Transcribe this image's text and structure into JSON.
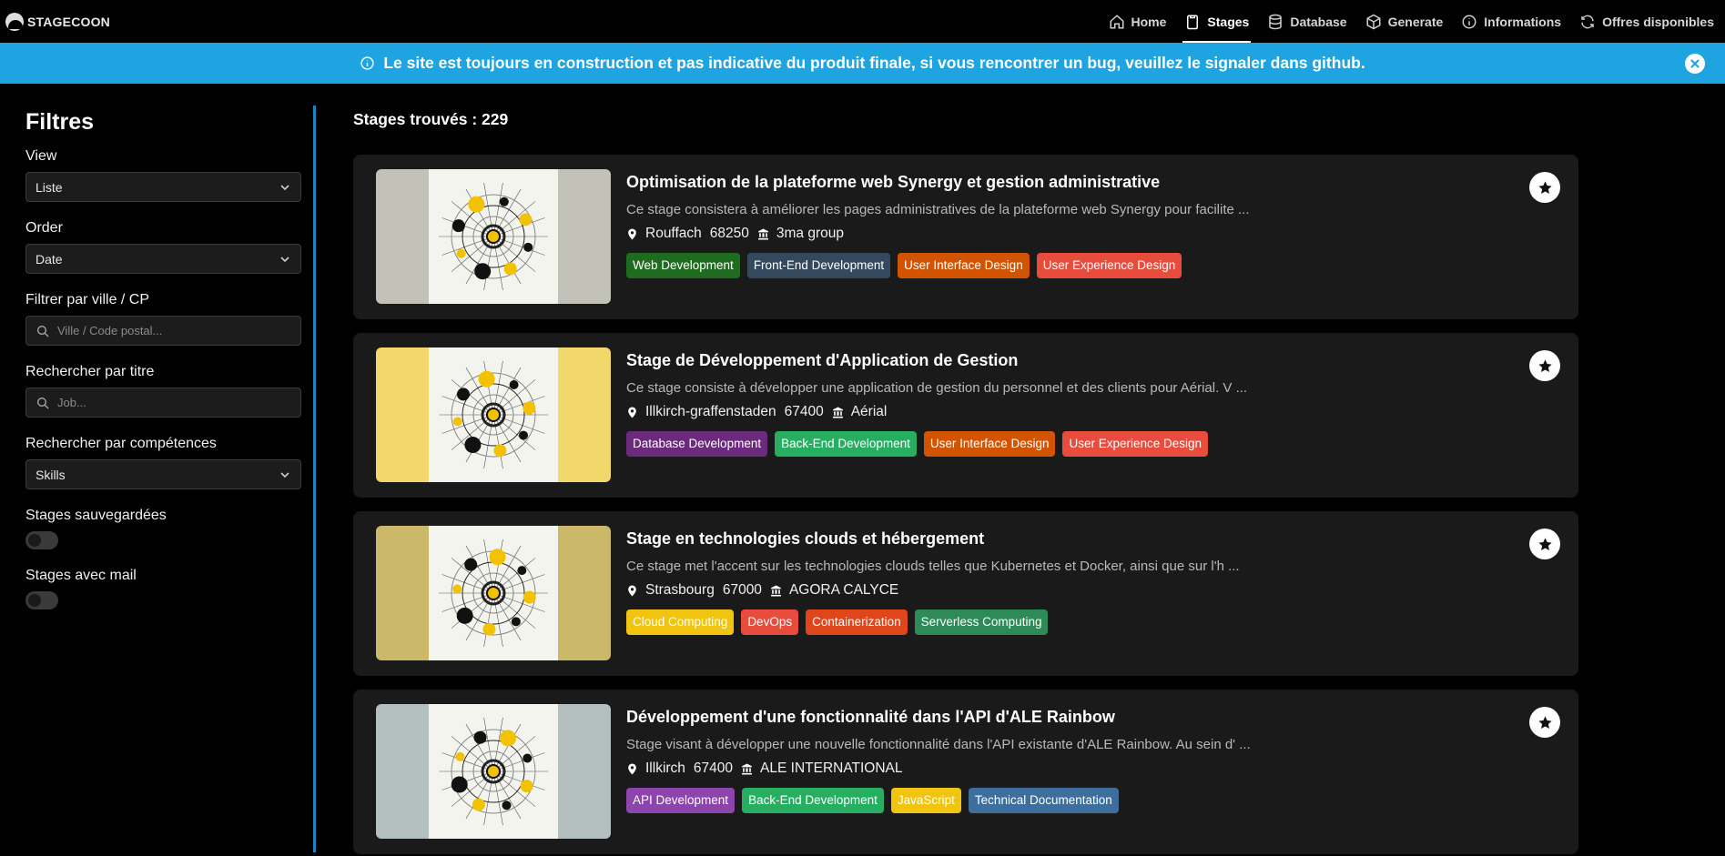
{
  "brand": {
    "name": "STAGECOON"
  },
  "nav": [
    {
      "label": "Home",
      "icon": "home-icon"
    },
    {
      "label": "Stages",
      "icon": "clipboard-icon",
      "active": true
    },
    {
      "label": "Database",
      "icon": "database-icon"
    },
    {
      "label": "Generate",
      "icon": "cube-icon"
    },
    {
      "label": "Informations",
      "icon": "info-icon"
    },
    {
      "label": "Offres disponibles",
      "icon": "refresh-icon"
    }
  ],
  "banner": {
    "text": "Le site est toujours en construction et pas indicative du produit finale, si vous rencontrer un bug, veuillez le signaler dans github.",
    "color": "#1ea4e0"
  },
  "sidebar": {
    "title": "Filtres",
    "view": {
      "label": "View",
      "value": "Liste"
    },
    "order": {
      "label": "Order",
      "value": "Date"
    },
    "city": {
      "label": "Filtrer par ville / CP",
      "placeholder": "Ville / Code postal..."
    },
    "title_search": {
      "label": "Rechercher par titre",
      "placeholder": "Job..."
    },
    "skills": {
      "label": "Rechercher par compétences",
      "value": "Skills"
    },
    "saved": {
      "label": "Stages sauvegardées",
      "on": false
    },
    "with_mail": {
      "label": "Stages avec mail",
      "on": false
    }
  },
  "results": {
    "count_text": "Stages trouvés : 229"
  },
  "cards": [
    {
      "title": "Optimisation de la plateforme web Synergy et gestion administrative",
      "description": "Ce stage consistera à améliorer les pages administratives de la plateforme web Synergy pour facilite ...",
      "city": "Rouffach",
      "postcode": "68250",
      "company": "3ma group",
      "image_bg": "#c2c2b8",
      "tags": [
        {
          "label": "Web Development",
          "color": "#1f6b1f"
        },
        {
          "label": "Front-End Development",
          "color": "#34495e"
        },
        {
          "label": "User Interface Design",
          "color": "#d35400"
        },
        {
          "label": "User Experience Design",
          "color": "#e74c3c"
        }
      ]
    },
    {
      "title": "Stage de Développement d'Application de Gestion",
      "description": "Ce stage consiste à développer une application de gestion du personnel et des clients pour Aérial. V ...",
      "city": "Illkirch-graffenstaden",
      "postcode": "67400",
      "company": "Aérial",
      "image_bg": "#f2d76a",
      "tags": [
        {
          "label": "Database Development",
          "color": "#6c2a7c"
        },
        {
          "label": "Back-End Development",
          "color": "#27ae60"
        },
        {
          "label": "User Interface Design",
          "color": "#d35400"
        },
        {
          "label": "User Experience Design",
          "color": "#e74c3c"
        }
      ]
    },
    {
      "title": "Stage en technologies clouds et hébergement",
      "description": "Ce stage met l'accent sur les technologies clouds telles que Kubernetes et Docker, ainsi que sur l'h ...",
      "city": "Strasbourg",
      "postcode": "67000",
      "company": "AGORA CALYCE",
      "image_bg": "#cbb868",
      "tags": [
        {
          "label": "Cloud Computing",
          "color": "#f1c40f"
        },
        {
          "label": "DevOps",
          "color": "#e74c3c"
        },
        {
          "label": "Containerization",
          "color": "#e0461c"
        },
        {
          "label": "Serverless Computing",
          "color": "#2e8b57"
        }
      ]
    },
    {
      "title": "Développement d'une fonctionnalité dans l'API d'ALE Rainbow",
      "description": "Stage visant à développer une nouvelle fonctionnalité dans l'API existante d'ALE Rainbow. Au sein d' ...",
      "city": "Illkirch",
      "postcode": "67400",
      "company": "ALE INTERNATIONAL",
      "image_bg": "#b4c0c0",
      "tags": [
        {
          "label": "API Development",
          "color": "#8e44ad"
        },
        {
          "label": "Back-End Development",
          "color": "#27ae60"
        },
        {
          "label": "JavaScript",
          "color": "#f1c40f"
        },
        {
          "label": "Technical Documentation",
          "color": "#3d6f9e"
        }
      ]
    }
  ]
}
